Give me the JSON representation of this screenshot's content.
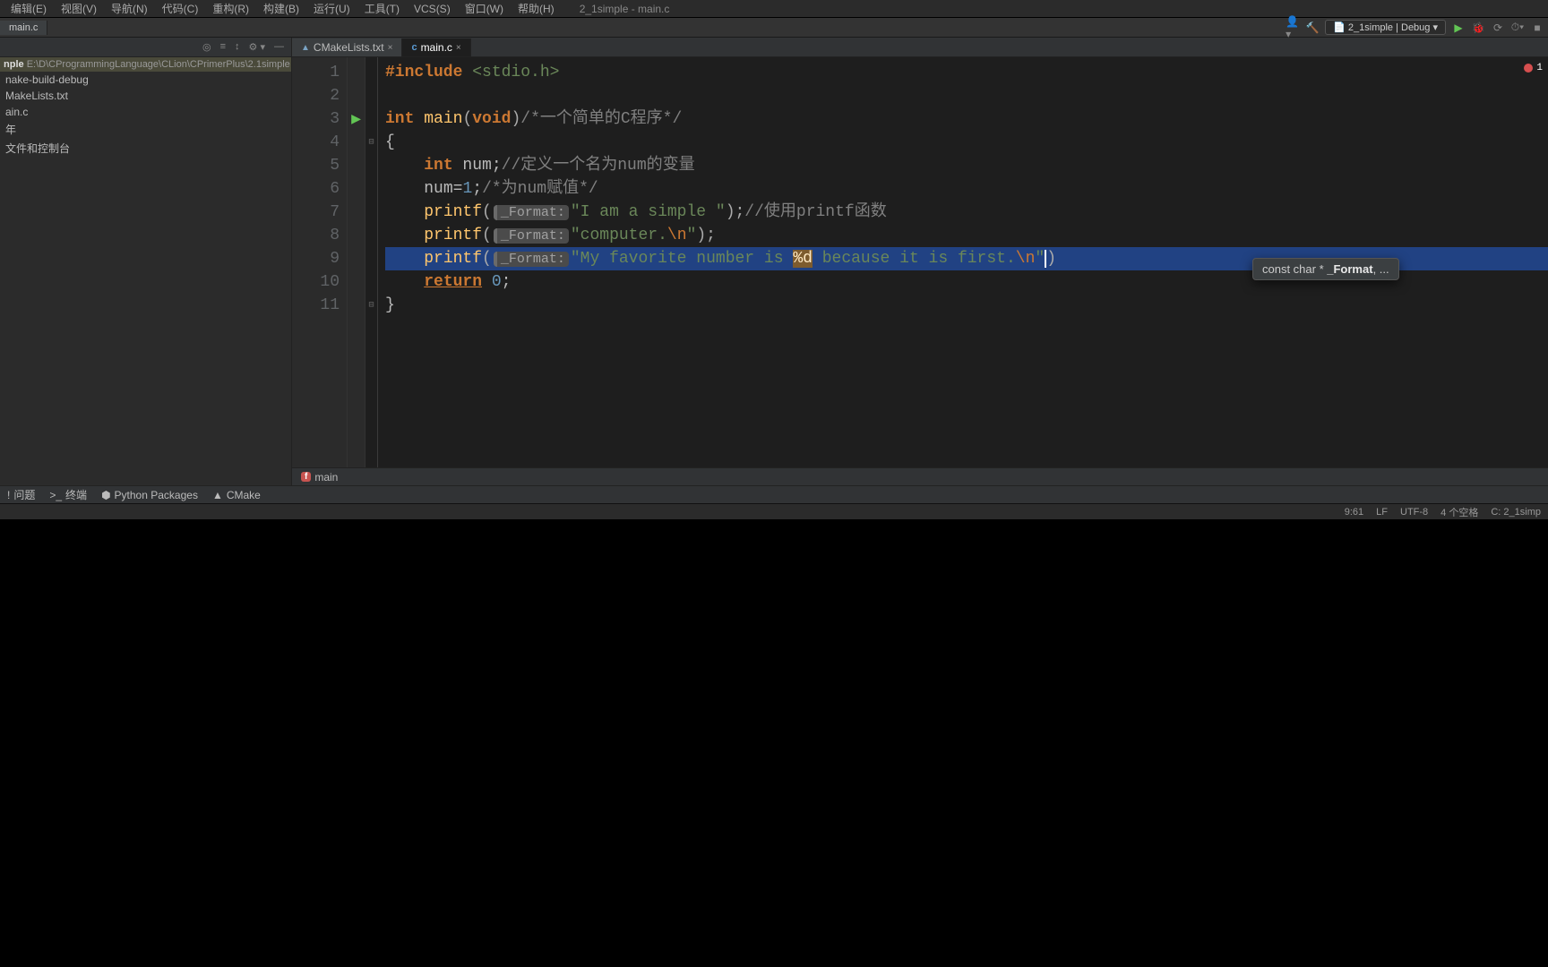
{
  "title_bar": {
    "project": "2_1simple - main.c"
  },
  "menu": [
    "编辑(E)",
    "视图(V)",
    "导航(N)",
    "代码(C)",
    "重构(R)",
    "构建(B)",
    "运行(U)",
    "工具(T)",
    "VCS(S)",
    "窗口(W)",
    "帮助(H)"
  ],
  "open_file_tab": "main.c",
  "run_config": "2_1simple | Debug",
  "sidebar": {
    "root_name": "nple",
    "root_path": "E:\\D\\CProgrammingLanguage\\CLion\\CPrimerPlus\\2.1simple",
    "items": [
      "nake-build-debug",
      "MakeLists.txt",
      "ain.c",
      "年",
      "文件和控制台"
    ]
  },
  "editor_tabs": [
    {
      "icon": "cmake",
      "label": "CMakeLists.txt",
      "active": false
    },
    {
      "icon": "c",
      "label": "main.c",
      "active": true
    }
  ],
  "code": {
    "l1": {
      "kw": "#include",
      "inc": " <stdio.h>"
    },
    "l3": {
      "kw1": "int",
      "fn": "main",
      "p1": "(",
      "kw2": "void",
      "p2": ")",
      "cmt": "/*一个简单的C程序*/"
    },
    "l4": "{",
    "l5": {
      "kw": "int",
      "var": " num;",
      "cmt": "//定义一个名为num的变量"
    },
    "l6": {
      "txt": "num=",
      "num": "1",
      "semi": ";",
      "cmt": "/*为num赋值*/"
    },
    "l7": {
      "fn": "printf",
      "p1": "(",
      "hint": "_Format:",
      "str": "\"I am a simple \"",
      "p2": ");",
      "cmt": "//使用printf函数"
    },
    "l8": {
      "fn": "printf",
      "p1": "(",
      "hint": "_Format:",
      "str1": "\"computer.",
      "esc": "\\n",
      "str2": "\"",
      "p2": ");"
    },
    "l9": {
      "fn": "printf",
      "p1": "(",
      "hint": "_Format:",
      "str1": "\"My favorite number is ",
      "fmt": "%d",
      "str2": " because it is first.",
      "esc": "\\n",
      "str3": "\"",
      "p2": ")"
    },
    "l10": {
      "kw": "return",
      "num": " 0",
      "semi": ";"
    },
    "l11": "}"
  },
  "tooltip": {
    "pre": "const char * ",
    "bold": "_Format",
    "post": ", ..."
  },
  "error_count": "1",
  "breadcrumb": {
    "badge": "f",
    "label": "main"
  },
  "bottom_tools": [
    {
      "icon": "!",
      "label": "问题"
    },
    {
      "icon": ">_",
      "label": "终端"
    },
    {
      "icon": "⬢",
      "label": "Python Packages"
    },
    {
      "icon": "▲",
      "label": "CMake"
    }
  ],
  "status": {
    "pos": "9:61",
    "eol": "LF",
    "enc": "UTF-8",
    "indent": "4 个空格",
    "ctx": "C: 2_1simp"
  }
}
